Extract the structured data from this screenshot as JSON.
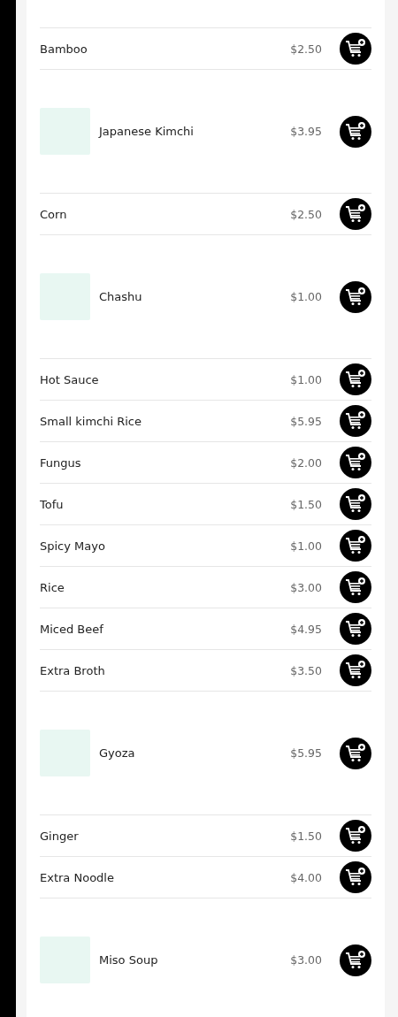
{
  "items": [
    {
      "kind": "plain",
      "name": "Bamboo",
      "price": "$2.50"
    },
    {
      "kind": "image",
      "name": "Japanese Kimchi",
      "price": "$3.95"
    },
    {
      "kind": "plain",
      "name": "Corn",
      "price": "$2.50"
    },
    {
      "kind": "image",
      "name": "Chashu",
      "price": "$1.00"
    },
    {
      "kind": "plain",
      "name": "Hot Sauce",
      "price": "$1.00"
    },
    {
      "kind": "plain",
      "name": "Small kimchi Rice",
      "price": "$5.95"
    },
    {
      "kind": "plain",
      "name": "Fungus",
      "price": "$2.00"
    },
    {
      "kind": "plain",
      "name": "Tofu",
      "price": "$1.50"
    },
    {
      "kind": "plain",
      "name": "Spicy Mayo",
      "price": "$1.00"
    },
    {
      "kind": "plain",
      "name": "Rice",
      "price": "$3.00"
    },
    {
      "kind": "plain",
      "name": "Miced Beef",
      "price": "$4.95"
    },
    {
      "kind": "plain",
      "name": "Extra Broth",
      "price": "$3.50"
    },
    {
      "kind": "image",
      "name": "Gyoza",
      "price": "$5.95"
    },
    {
      "kind": "plain",
      "name": "Ginger",
      "price": "$1.50"
    },
    {
      "kind": "plain",
      "name": "Extra Noodle",
      "price": "$4.00"
    },
    {
      "kind": "image",
      "name": "Miso Soup",
      "price": "$3.00"
    }
  ]
}
